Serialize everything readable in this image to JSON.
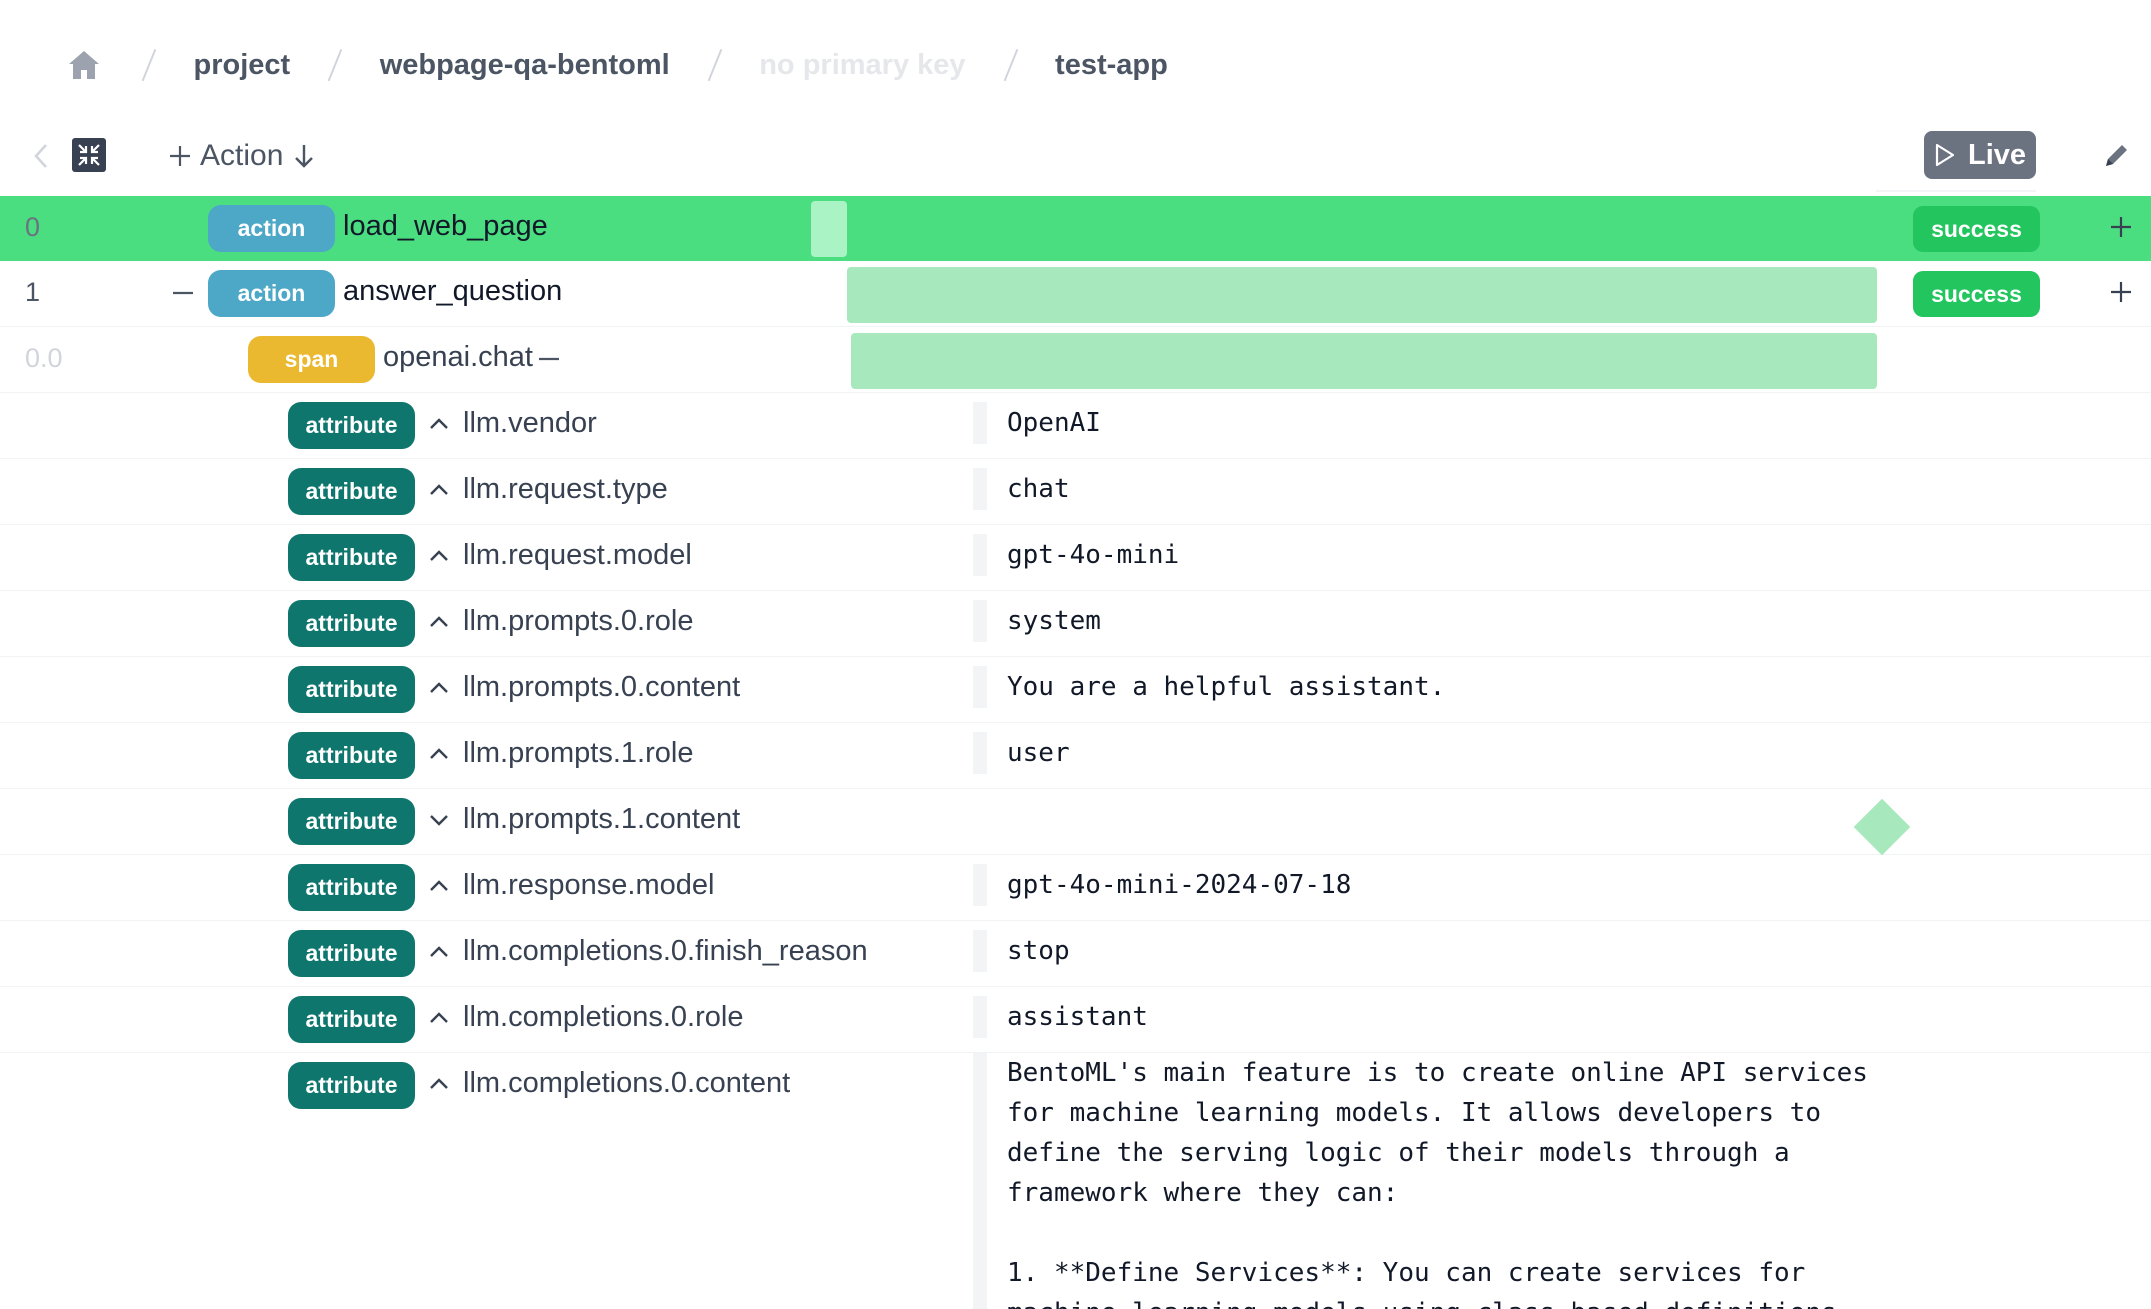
{
  "breadcrumb": {
    "items": [
      "project",
      "webpage-qa-bentoml",
      "no primary key",
      "test-app"
    ]
  },
  "toolbar": {
    "action_label": "Action",
    "live_label": "Live"
  },
  "rows": [
    {
      "index": "0",
      "tag": "action",
      "name": "load_web_page",
      "status": "success"
    },
    {
      "index": "1",
      "tag": "action",
      "name": "answer_question",
      "status": "success"
    },
    {
      "index": "0.0",
      "tag": "span",
      "name": "openai.chat"
    }
  ],
  "attributes": [
    {
      "tag": "attribute",
      "key": "llm.vendor",
      "value": "OpenAI"
    },
    {
      "tag": "attribute",
      "key": "llm.request.type",
      "value": "chat"
    },
    {
      "tag": "attribute",
      "key": "llm.request.model",
      "value": "gpt-4o-mini"
    },
    {
      "tag": "attribute",
      "key": "llm.prompts.0.role",
      "value": "system"
    },
    {
      "tag": "attribute",
      "key": "llm.prompts.0.content",
      "value": "You are a helpful assistant."
    },
    {
      "tag": "attribute",
      "key": "llm.prompts.1.role",
      "value": "user"
    },
    {
      "tag": "attribute",
      "key": "llm.prompts.1.content",
      "value": ""
    },
    {
      "tag": "attribute",
      "key": "llm.response.model",
      "value": "gpt-4o-mini-2024-07-18"
    },
    {
      "tag": "attribute",
      "key": "llm.completions.0.finish_reason",
      "value": "stop"
    },
    {
      "tag": "attribute",
      "key": "llm.completions.0.role",
      "value": "assistant"
    },
    {
      "tag": "attribute",
      "key": "llm.completions.0.content",
      "value": "BentoML's main feature is to create online API services\nfor machine learning models. It allows developers to\ndefine the serving logic of their models through a\nframework where they can:\n\n1. **Define Services**: You can create services for\nmachine learning models using class-based definitions,"
    }
  ],
  "colors": {
    "selected_row": "#4ade80",
    "status_success": "#22c55e",
    "timeline_bar": "#a7e8bd",
    "action_tag": "#4da7c6",
    "span_tag": "#eab92f",
    "attribute_tag": "#0f766e"
  },
  "icons": [
    "home-icon",
    "chevron-left-icon",
    "collapse-all-icon",
    "plus-icon",
    "arrow-down-icon",
    "play-icon",
    "pencil-icon",
    "minus-icon",
    "chevron-up-icon",
    "chevron-down-icon"
  ]
}
